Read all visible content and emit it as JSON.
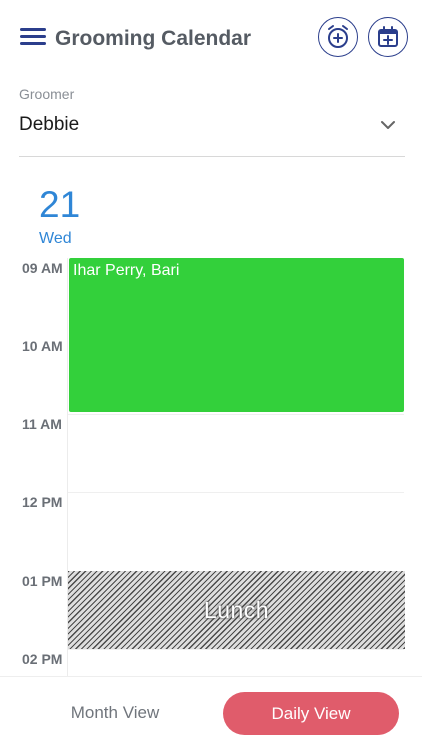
{
  "header": {
    "title": "Grooming Calendar",
    "menu_icon": "hamburger-menu-icon",
    "add_alarm_icon": "add-alarm-icon",
    "add_event_icon": "calendar-add-icon"
  },
  "groomer": {
    "label": "Groomer",
    "selected": "Debbie"
  },
  "date": {
    "day_number": "21",
    "weekday": "Wed"
  },
  "calendar": {
    "hours": [
      "09 AM",
      "10 AM",
      "11 AM",
      "12 PM",
      "01 PM",
      "02 PM"
    ],
    "events": [
      {
        "title": "Ihar Perry, Bari",
        "color": "#33d03b"
      }
    ],
    "blocked": {
      "label": "Lunch"
    }
  },
  "bottom_nav": {
    "month_view": "Month View",
    "daily_view": "Daily View"
  },
  "colors": {
    "primary": "#2b3e8c",
    "accent_date": "#2f86d6",
    "active_tab": "#e05c6b"
  }
}
